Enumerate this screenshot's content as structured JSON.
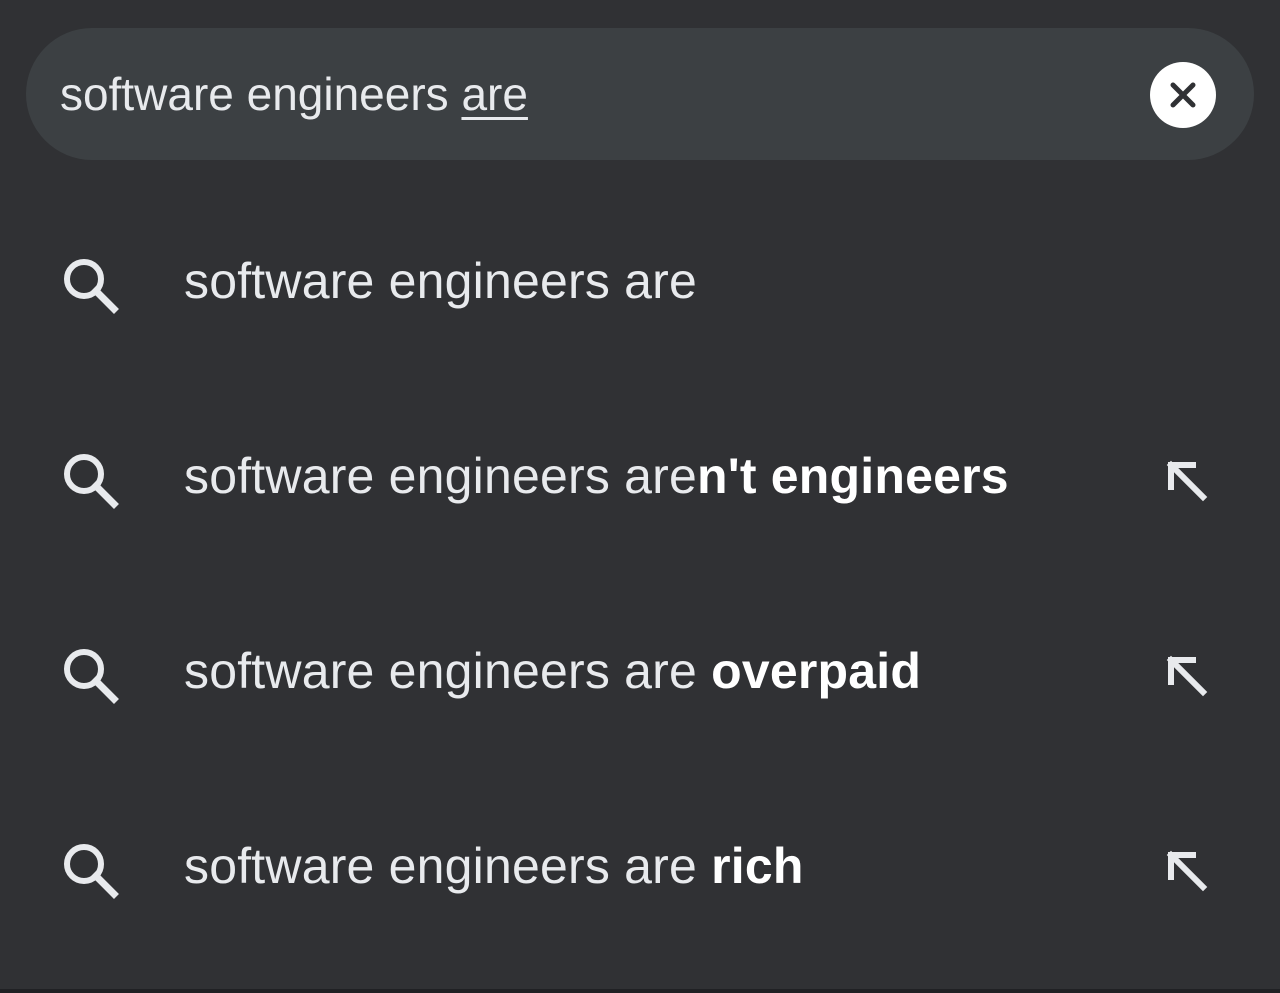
{
  "search": {
    "query_typed": "software engineers ",
    "query_composing": "are"
  },
  "suggestions": [
    {
      "base": "software engineers are",
      "bold": "",
      "icon": "search-icon",
      "fill_icon": null
    },
    {
      "base": "software engineers are",
      "bold": "n't engineers",
      "icon": "search-icon",
      "fill_icon": "arrow-up-left-icon"
    },
    {
      "base": "software engineers are ",
      "bold": "overpaid",
      "icon": "search-icon",
      "fill_icon": "arrow-up-left-icon"
    },
    {
      "base": "software engineers are ",
      "bold": "rich",
      "icon": "search-icon",
      "fill_icon": "arrow-up-left-icon"
    }
  ],
  "colors": {
    "background": "#303134",
    "search_box": "#3c4043",
    "text": "#e8eaed",
    "clear_button": "#ffffff"
  }
}
